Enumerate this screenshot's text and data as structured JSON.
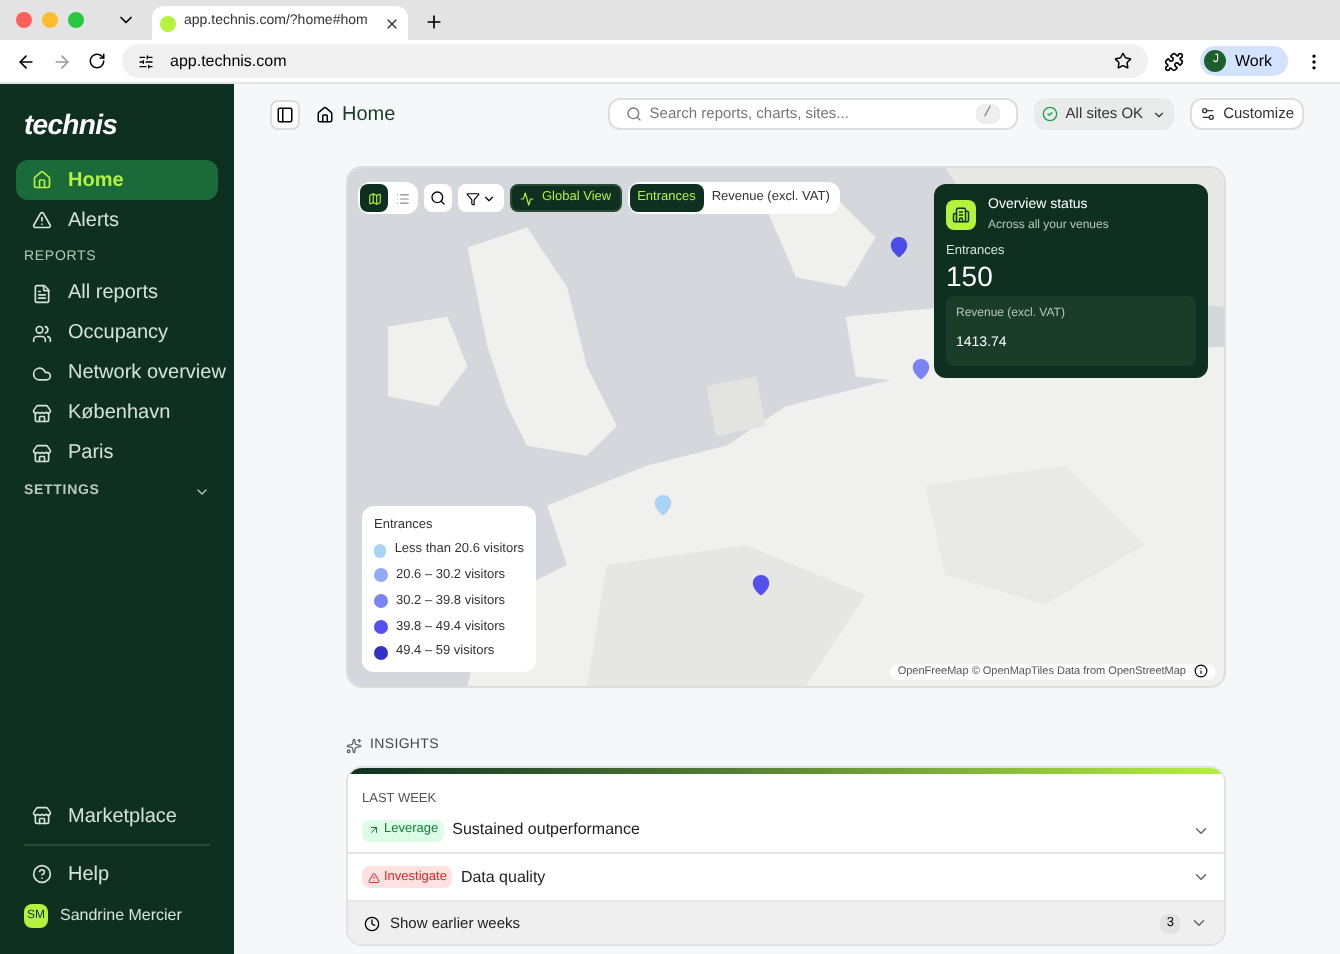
{
  "browser": {
    "tab_title": "app.technis.com/?home#hom",
    "url": "app.technis.com",
    "profile_initial": "J",
    "profile_name": "Work"
  },
  "sidebar": {
    "logo": "technis",
    "items": [
      {
        "label": "Home",
        "selected": true
      },
      {
        "label": "Alerts",
        "selected": false
      }
    ],
    "reports_heading": "REPORTS",
    "reports": [
      {
        "label": "All reports",
        "selected": false
      },
      {
        "label": "Occupancy",
        "selected": false
      },
      {
        "label": "Network overview",
        "selected": false
      },
      {
        "label": "København",
        "selected": false
      },
      {
        "label": "Paris",
        "selected": false
      }
    ],
    "settings_heading": "SETTINGS",
    "settings_expanded": false,
    "marketplace": "Marketplace",
    "help": "Help",
    "user": {
      "initials": "SM",
      "name": "Sandrine Mercier"
    }
  },
  "header": {
    "breadcrumb": "Home",
    "search": {
      "placeholder": "Search reports, charts, sites...",
      "shortcut": "/"
    },
    "status": "All sites OK",
    "customize": "Customize"
  },
  "map": {
    "view_modes": [
      {
        "selected": true
      },
      {
        "selected": false
      }
    ],
    "global_view": "Global View",
    "metrics": [
      {
        "label": "Entrances",
        "selected": true
      },
      {
        "label": "Revenue (excl. VAT)",
        "selected": false
      }
    ],
    "overview": {
      "title": "Overview status",
      "subtitle": "Across all your venues",
      "metric_label": "Entrances",
      "metric_value": "150",
      "revenue_label": "Revenue (excl. VAT)",
      "revenue_value": "1413.74"
    },
    "legend": {
      "title": "Entrances",
      "items": [
        {
          "label": "Less than 20.6 visitors",
          "color": "#a9d3f3"
        },
        {
          "label": "20.6 – 30.2 visitors",
          "color": "#92a9f6"
        },
        {
          "label": "30.2 – 39.8 visitors",
          "color": "#7b84f3"
        },
        {
          "label": "39.8 – 49.4 visitors",
          "color": "#5450ee"
        },
        {
          "label": "49.4 – 59 visitors",
          "color": "#3432c4"
        }
      ]
    },
    "pins": [
      {
        "color": "#4a4ee6"
      },
      {
        "color": "#7b84f3"
      },
      {
        "color": "#a9d3f3"
      },
      {
        "color": "#5450ee"
      }
    ],
    "attribution": "OpenFreeMap © OpenMapTiles Data from OpenStreetMap"
  },
  "insights": {
    "heading": "INSIGHTS",
    "period": "LAST WEEK",
    "items": [
      {
        "tag": "Leverage",
        "kind": "leverage",
        "title": "Sustained outperformance"
      },
      {
        "tag": "Investigate",
        "kind": "investigate",
        "title": "Data quality"
      }
    ],
    "earlier": {
      "label": "Show earlier weeks",
      "count": "3"
    }
  }
}
